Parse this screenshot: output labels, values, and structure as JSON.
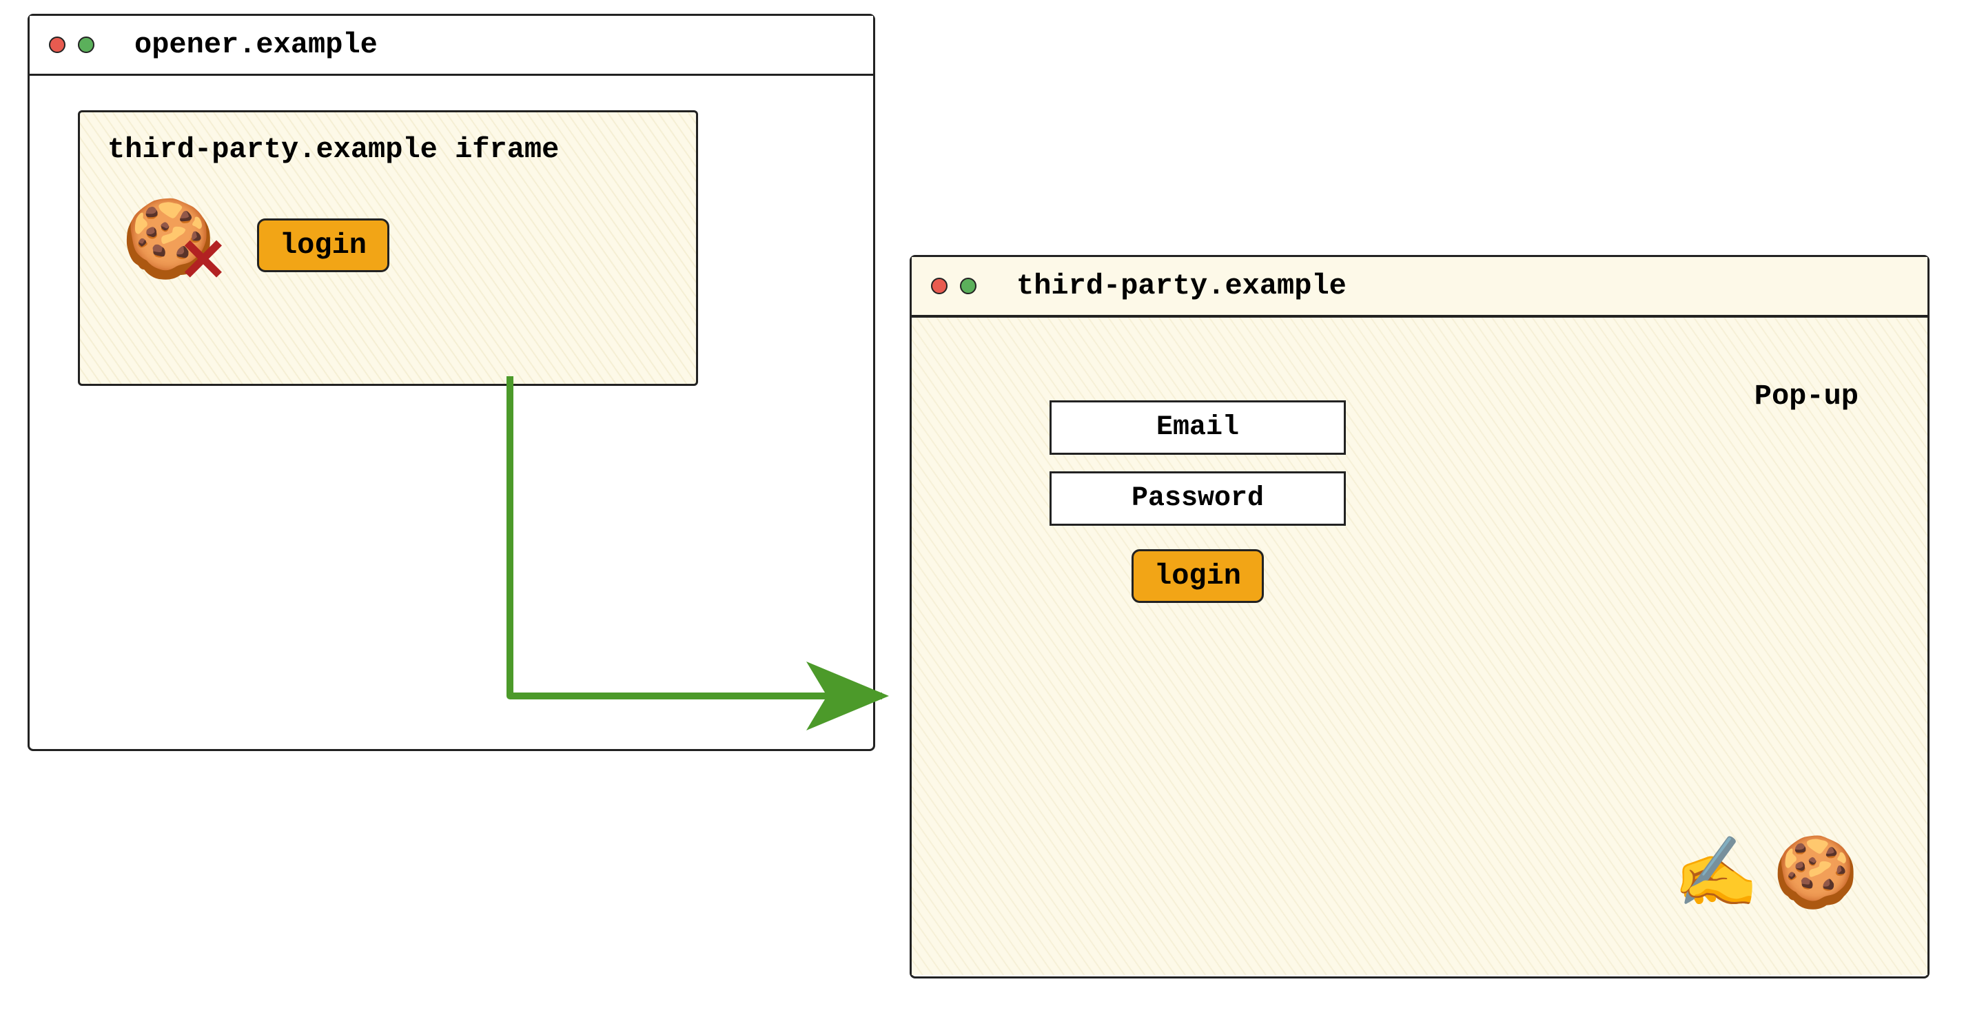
{
  "opener_window": {
    "title": "opener.example",
    "iframe": {
      "label": "third-party.example iframe",
      "cookie_icon": "🍪",
      "blocked_mark": "✕",
      "login_button": "login"
    }
  },
  "popup_window": {
    "title": "third-party.example",
    "label": "Pop-up",
    "form": {
      "email_label": "Email",
      "password_label": "Password",
      "login_button": "login"
    },
    "writing_icon": "✍️",
    "cookie_icon": "🍪"
  },
  "colors": {
    "accent": "#f2a516",
    "arrow": "#4c9a2a",
    "dot_red": "#e85b50",
    "dot_green": "#5bb05b"
  }
}
